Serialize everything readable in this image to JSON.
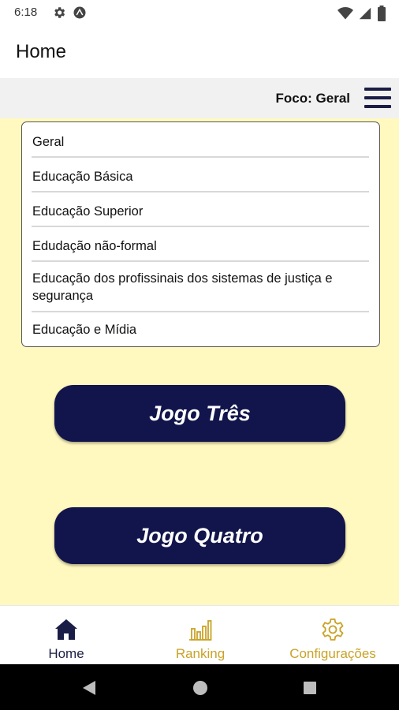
{
  "status": {
    "time": "6:18",
    "icons": [
      "gear-icon",
      "android-icon",
      "wifi-icon",
      "signal-icon",
      "battery-icon"
    ]
  },
  "app_bar": {
    "title": "Home"
  },
  "focus": {
    "label": "Foco: Geral",
    "menu_icon": "hamburger-menu-icon"
  },
  "dropdown": {
    "items": [
      "Geral",
      "Educação Básica",
      "Educação Superior",
      "Edudação não-formal",
      "Educação dos profissinais  dos sistemas de justiça e segurança",
      "Educação e Mídia"
    ]
  },
  "buttons": {
    "game_three": "Jogo Três",
    "game_four": "Jogo Quatro"
  },
  "bottom_nav": {
    "items": [
      {
        "label": "Home",
        "icon": "home-icon",
        "active": true
      },
      {
        "label": "Ranking",
        "icon": "bar-chart-icon",
        "active": false
      },
      {
        "label": "Configurações",
        "icon": "settings-gear-icon",
        "active": false
      }
    ]
  },
  "colors": {
    "primary_navy": "#12154b",
    "background_yellow": "#fff8bf",
    "nav_inactive_gold": "#c9a227",
    "nav_active": "#1a1d45"
  },
  "system_nav": {
    "icons": [
      "back-icon",
      "home-circle-icon",
      "recents-square-icon"
    ]
  }
}
